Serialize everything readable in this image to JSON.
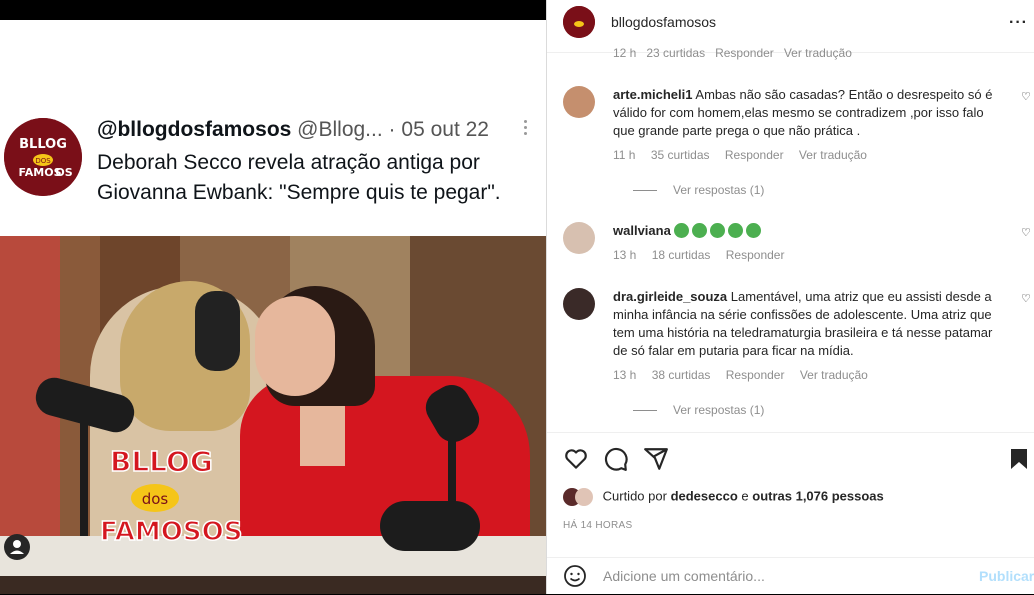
{
  "post": {
    "tweet": {
      "handle": "@bllogdosfamosos",
      "handle_alt": "@Bllog...",
      "separator": "·",
      "date": "05 out 22",
      "text": "Deborah Secco revela atração antiga por Giovanna Ewbank: \"Sempre quis te pegar\".",
      "avatar_logo_lines": [
        "BLLOG",
        "DOS",
        "FAMOS",
        "OS"
      ]
    },
    "watermark": {
      "line1": "BLLOG",
      "line2": "dos",
      "line3": "FAMOSOS"
    }
  },
  "panel": {
    "account_name": "bllogdosfamosos",
    "more_icon": "more-horizontal-icon",
    "cutoff_meta": [
      "12 h",
      "23 curtidas",
      "Responder",
      "Ver tradução"
    ],
    "comments": [
      {
        "username": "arte.micheli1",
        "text": "Ambas não são casadas? Então o desrespeito só é válido for com homem,elas mesmo se contradizem ,por isso falo que grande parte prega o que não prática .",
        "time": "11 h",
        "likes": "35 curtidas",
        "reply": "Responder",
        "translate": "Ver tradução",
        "view_replies": "Ver respostas (1)"
      },
      {
        "username": "wallviana",
        "text": "",
        "emoji_count": 5,
        "time": "13 h",
        "likes": "18 curtidas",
        "reply": "Responder"
      },
      {
        "username": "dra.girleide_souza",
        "text": "Lamentável, uma atriz que eu assisti desde a minha infância na série confissões de adolescente. Uma atriz que tem uma história na teledramaturgia brasileira e tá nesse patamar de só falar em putaria para ficar na mídia.",
        "time": "13 h",
        "likes": "38 curtidas",
        "reply": "Responder",
        "translate": "Ver tradução",
        "view_replies": "Ver respostas (1)"
      }
    ],
    "liked_prefix": "Curtido por",
    "liked_user": "dedesecco",
    "liked_and": "e",
    "liked_others": "outras 1,076 pessoas",
    "time_ago": "HÁ 14 HORAS",
    "comment_placeholder": "Adicione um comentário...",
    "publish_label": "Publicar"
  },
  "colors": {
    "brand_red": "#7a0f18",
    "publish_disabled": "#b2dffc",
    "meta_gray": "#8e8e8e"
  }
}
